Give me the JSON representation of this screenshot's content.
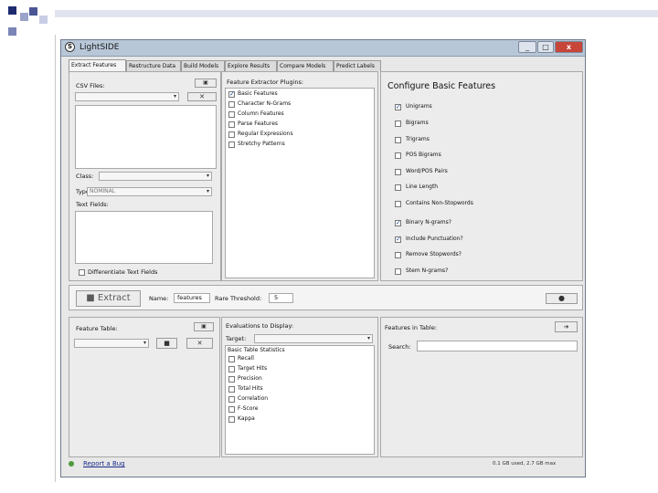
{
  "app": {
    "title": "LightSIDE"
  },
  "window_controls": {
    "minimize": "_",
    "maximize": "□",
    "close": "x"
  },
  "tabs": [
    "Extract Features",
    "Restructure Data",
    "Build Models",
    "Explore Results",
    "Compare Models",
    "Predict Labels"
  ],
  "left": {
    "csv_label": "CSV Files:",
    "class_label": "Class:",
    "type_label": "Type:",
    "type_value": "NOMINAL",
    "text_fields_label": "Text Fields:",
    "differentiate_label": "Differentiate Text Fields"
  },
  "plugins": {
    "label": "Feature Extractor Plugins:",
    "items": [
      {
        "label": "Basic Features",
        "checked": true
      },
      {
        "label": "Character N-Grams",
        "checked": false
      },
      {
        "label": "Column Features",
        "checked": false
      },
      {
        "label": "Parse Features",
        "checked": false
      },
      {
        "label": "Regular Expressions",
        "checked": false
      },
      {
        "label": "Stretchy Patterns",
        "checked": false
      }
    ]
  },
  "config": {
    "title": "Configure Basic Features",
    "options": [
      {
        "label": "Unigrams",
        "checked": true
      },
      {
        "label": "Bigrams",
        "checked": false
      },
      {
        "label": "Trigrams",
        "checked": false
      },
      {
        "label": "POS Bigrams",
        "checked": false
      },
      {
        "label": "Word/POS Pairs",
        "checked": false
      },
      {
        "label": "Line Length",
        "checked": false
      },
      {
        "label": "Contains Non-Stopwords",
        "checked": false
      },
      {
        "label": "Binary N-grams?",
        "checked": true
      },
      {
        "label": "Include Punctuation?",
        "checked": true
      },
      {
        "label": "Remove Stopwords?",
        "checked": false
      },
      {
        "label": "Stem N-grams?",
        "checked": false
      }
    ]
  },
  "extract": {
    "button": "Extract",
    "name_label": "Name:",
    "name_value": "features",
    "threshold_label": "Rare Threshold:",
    "threshold_value": "5"
  },
  "bottom": {
    "feature_table_label": "Feature Table:",
    "evaluations_label": "Evaluations to Display:",
    "target_label": "Target:",
    "metrics": [
      "Basic Table Statistics",
      "Recall",
      "Target Hits",
      "Precision",
      "Total Hits",
      "Correlation",
      "F-Score",
      "Kappa"
    ],
    "features_in_table_label": "Features in Table:",
    "search_label": "Search:"
  },
  "status": {
    "report_bug": "Report a Bug",
    "memory": "0.1 GB used, 2.7 GB max"
  }
}
